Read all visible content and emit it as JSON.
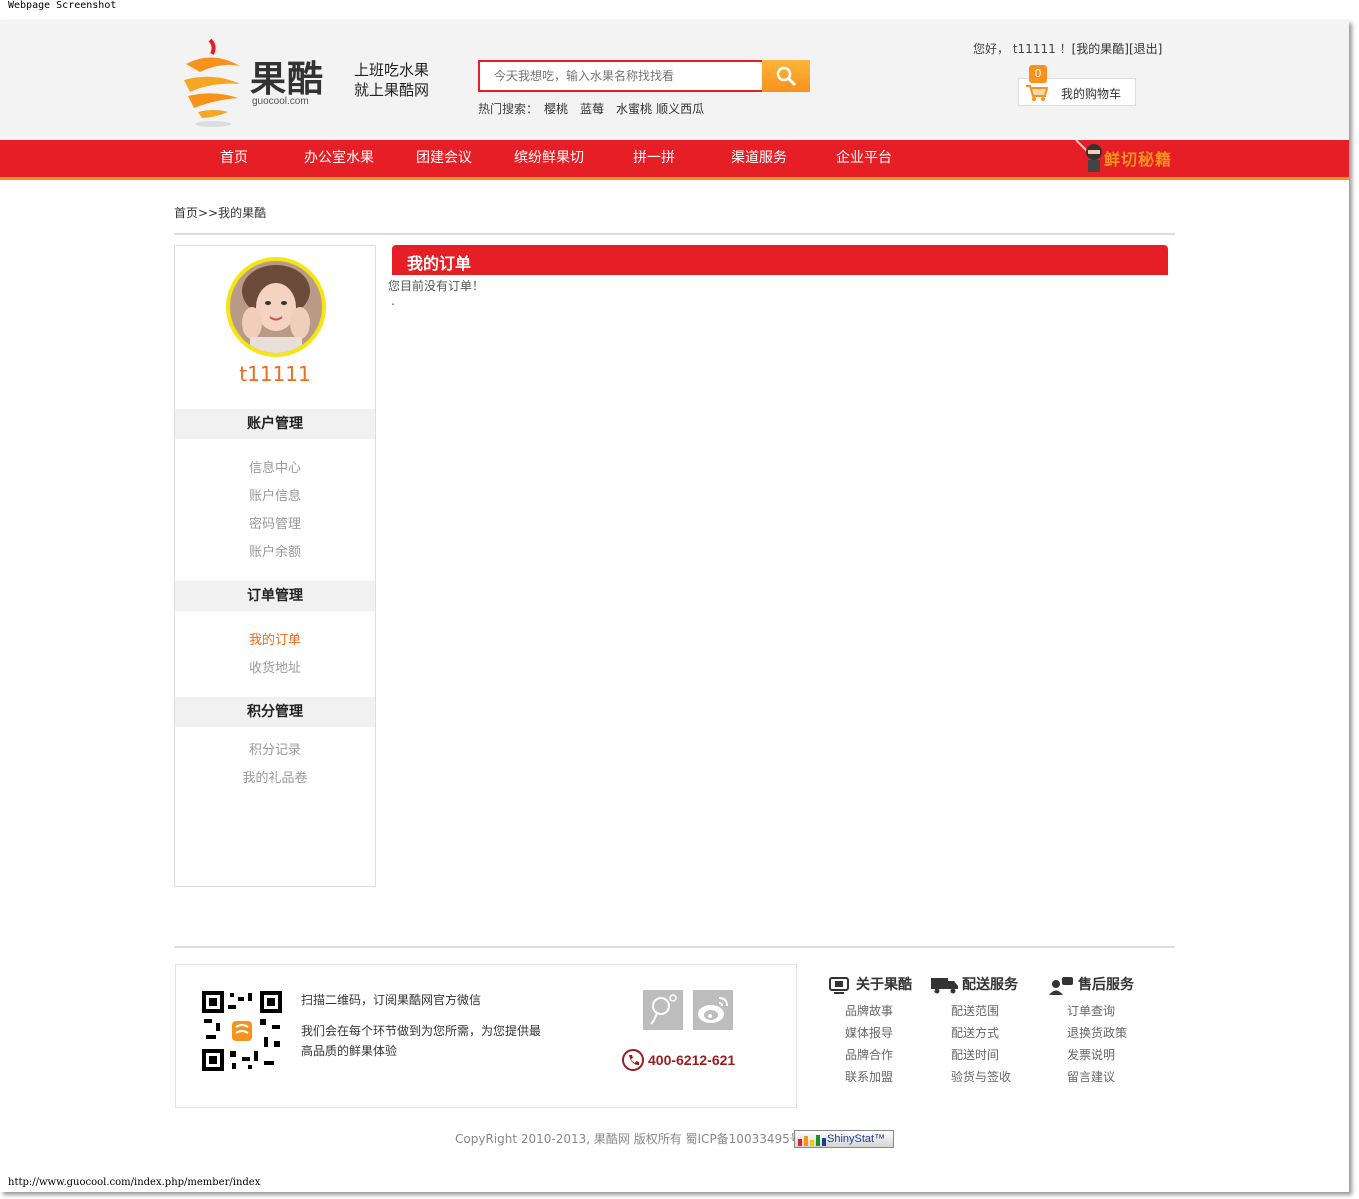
{
  "caption": "Webpage Screenshot",
  "url": "http://www.guocool.com/index.php/member/index",
  "brand": {
    "logo_text": "果酷",
    "domain": "guocool.com",
    "slogan_line1": "上班吃水果",
    "slogan_line2": "就上果酷网"
  },
  "search": {
    "placeholder": "今天我想吃，输入水果名称找找看",
    "hot_label": "热门搜索：",
    "hot_keywords": [
      "樱桃",
      "蓝莓",
      "水蜜桃",
      "顺义西瓜"
    ]
  },
  "user_bar": {
    "greeting": "您好，",
    "username": "t11111",
    "separator": "！",
    "my_account": "[我的果酷]",
    "logout": "[退出]"
  },
  "cart": {
    "count": "0",
    "label": "我的购物车"
  },
  "nav": {
    "items": [
      "首页",
      "办公室水果",
      "团建会议",
      "缤纷鲜果切",
      "拼一拼",
      "渠道服务",
      "企业平台"
    ],
    "promo": "鲜切秘籍"
  },
  "breadcrumb": "首页>>我的果酷",
  "sidebar": {
    "username": "t11111",
    "groups": [
      {
        "title": "账户管理",
        "items": [
          "信息中心",
          "账户信息",
          "密码管理",
          "账户余额"
        ]
      },
      {
        "title": "订单管理",
        "items": [
          "我的订单",
          "收货地址"
        ]
      },
      {
        "title": "积分管理",
        "items": [
          "积分记录",
          "我的礼品卷"
        ]
      }
    ]
  },
  "main": {
    "title": "我的订单",
    "empty_message": "您目前没有订单！",
    "dot": "."
  },
  "footer": {
    "qr_text1": "扫描二维码，订阅果酷网官方微信",
    "qr_text2": "我们会在每个环节做到为您所需，为您提供最高品质的鲜果体验",
    "phone": "400-6212-621",
    "columns": [
      {
        "title": "关于果酷",
        "links": [
          "品牌故事",
          "媒体报导",
          "品牌合作",
          "联系加盟"
        ]
      },
      {
        "title": "配送服务",
        "links": [
          "配送范围",
          "配送方式",
          "配送时间",
          "验货与签收"
        ]
      },
      {
        "title": "售后服务",
        "links": [
          "订单查询",
          "退换货政策",
          "发票说明",
          "留言建议"
        ]
      }
    ],
    "copyright": "CopyRight 2010-2013, 果酷网 版权所有 蜀ICP备10033495号",
    "badge": "ShinyStat™"
  },
  "colors": {
    "brand_red": "#e61e25",
    "brand_orange": "#f7921c",
    "accent_orange_text": "#f26a1c"
  }
}
